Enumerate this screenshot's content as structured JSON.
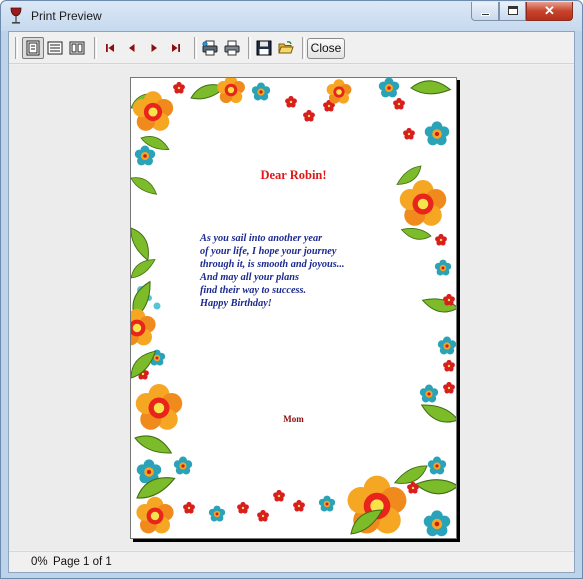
{
  "window": {
    "title": "Print Preview",
    "app_icon": "wine-glass-icon"
  },
  "toolbar": {
    "buttons": [
      {
        "name": "single-page-view-button",
        "icon": "single-page-icon"
      },
      {
        "name": "multi-page-view-button",
        "icon": "lines-page-icon"
      },
      {
        "name": "page-width-view-button",
        "icon": "page-width-icon"
      },
      {
        "name": "first-page-button",
        "icon": "first-page-icon"
      },
      {
        "name": "previous-page-button",
        "icon": "previous-page-icon"
      },
      {
        "name": "next-page-button",
        "icon": "next-page-icon"
      },
      {
        "name": "last-page-button",
        "icon": "last-page-icon"
      },
      {
        "name": "print-setup-button",
        "icon": "printer-setup-icon"
      },
      {
        "name": "print-button",
        "icon": "printer-icon"
      },
      {
        "name": "save-button",
        "icon": "floppy-disk-icon"
      },
      {
        "name": "open-button",
        "icon": "open-folder-icon"
      }
    ],
    "close_label": "Close"
  },
  "card": {
    "greeting": "Dear Robin!",
    "verse_lines": [
      "As you sail into another year",
      "of your life, I hope your journey",
      "through it, is smooth and joyous...",
      "And may all your plans",
      "find their way to success.",
      "Happy Birthday!"
    ],
    "signature": "Mom"
  },
  "status": {
    "zoom": "0%",
    "page": "Page 1 of 1"
  },
  "colors": {
    "greeting": "#e01818",
    "verse": "#1c2a8f",
    "signature": "#8b1010",
    "close_button_red": "#c7432b"
  }
}
